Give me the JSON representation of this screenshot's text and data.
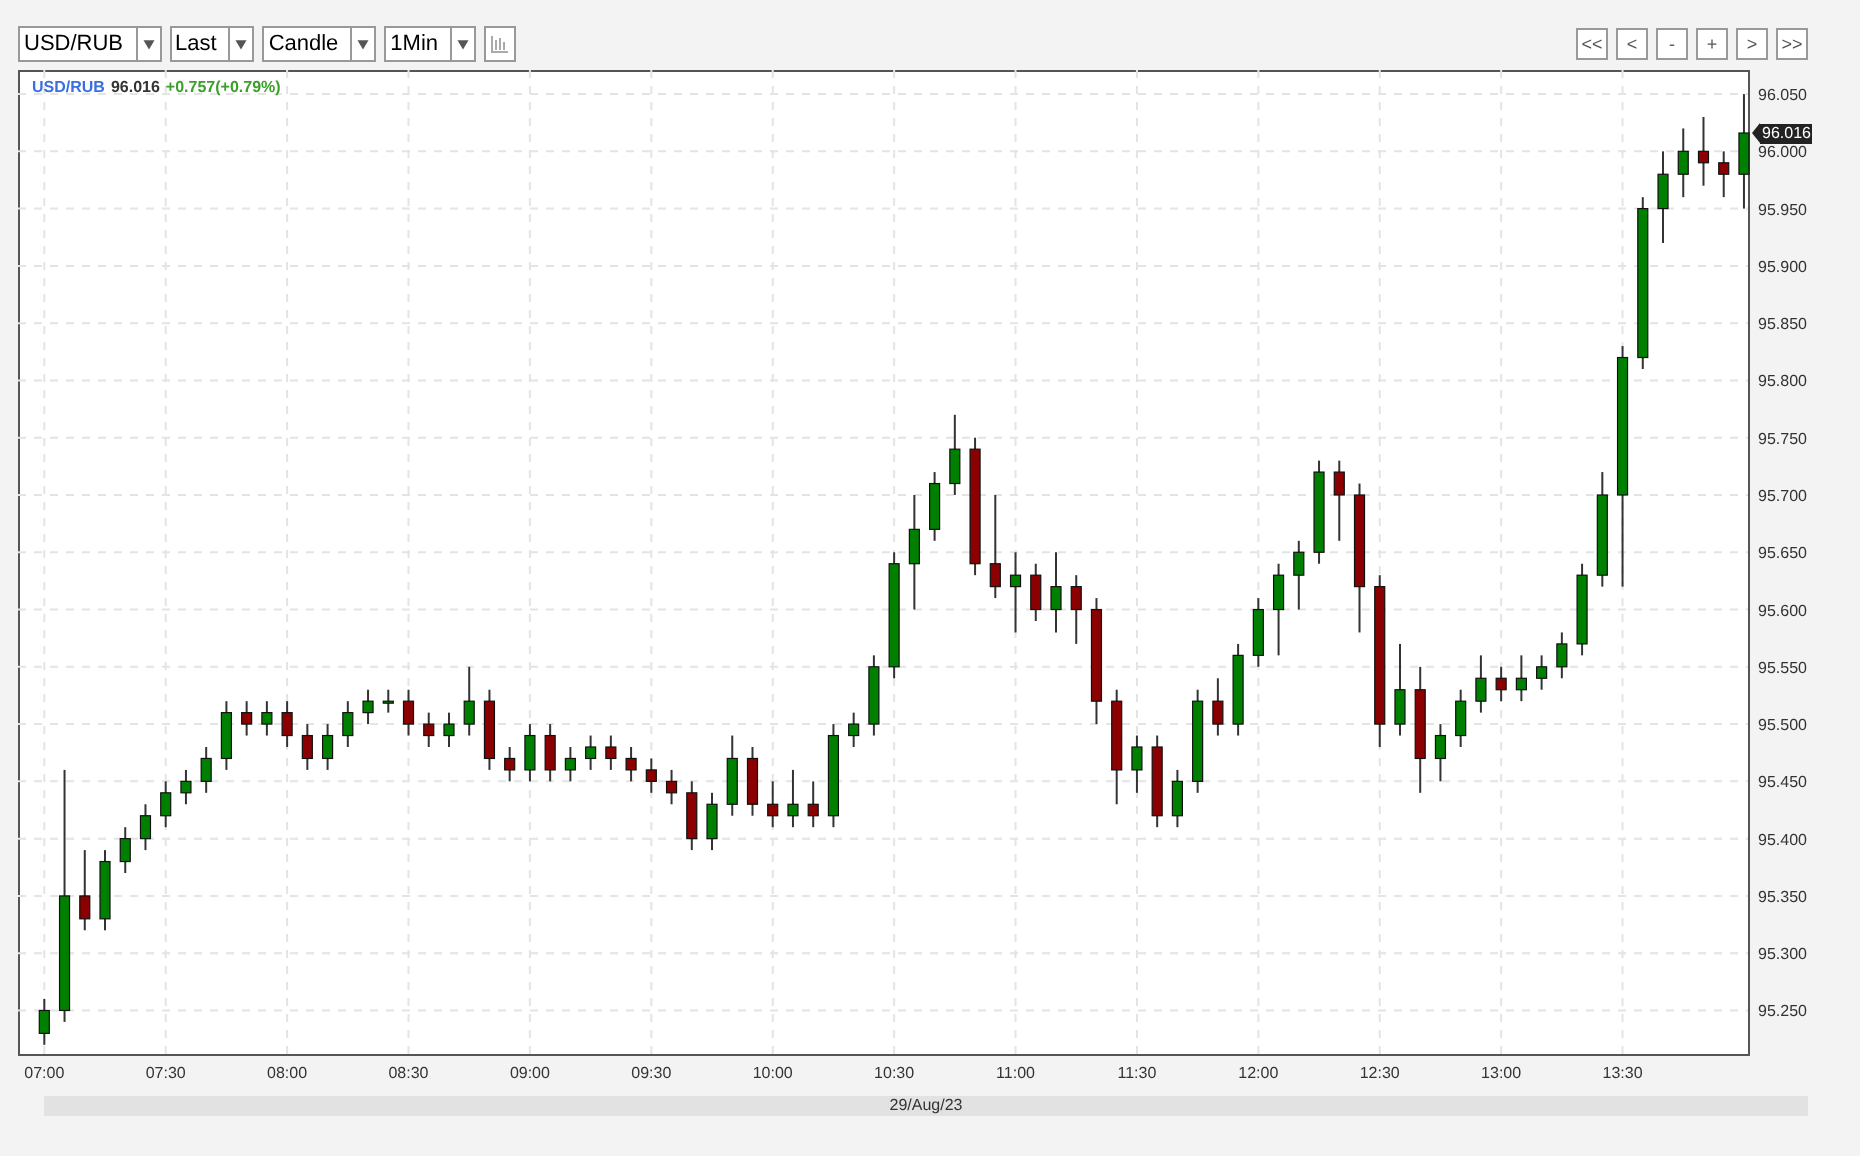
{
  "toolbar": {
    "selects": [
      "USD/RUB",
      "Last",
      "Candle",
      "1Min"
    ],
    "nav_buttons": [
      "<<",
      "<",
      "-",
      "+",
      ">",
      ">>"
    ]
  },
  "legend": {
    "symbol": "USD/RUB",
    "price": "96.016",
    "change": "+0.757(+0.79%)"
  },
  "price_marker": "96.016",
  "chart_data": {
    "type": "candlestick",
    "grid": true,
    "ylim": [
      95.212,
      96.071
    ],
    "categories": [
      "07:00",
      null,
      null,
      null,
      null,
      null,
      "07:30",
      null,
      null,
      null,
      null,
      null,
      "08:00",
      null,
      null,
      null,
      null,
      null,
      "08:30",
      null,
      null,
      null,
      null,
      null,
      "09:00",
      null,
      null,
      null,
      null,
      null,
      "09:30",
      null,
      null,
      null,
      null,
      null,
      "10:00",
      null,
      null,
      null,
      null,
      null,
      "10:30",
      null,
      null,
      null,
      null,
      null,
      "11:00",
      null,
      null,
      null,
      null,
      null,
      "11:30",
      null,
      null,
      null,
      null,
      null,
      "12:00",
      null,
      null,
      null,
      null,
      null,
      "12:30",
      null,
      null,
      null,
      null,
      null,
      "13:00",
      null,
      null,
      null,
      null,
      null,
      "13:30",
      null,
      null,
      null,
      null,
      null,
      null
    ],
    "yticks": [
      {
        "value": 95.25,
        "label": "95.250"
      },
      {
        "value": 95.3,
        "label": "95.300"
      },
      {
        "value": 95.35,
        "label": "95.350"
      },
      {
        "value": 95.4,
        "label": "95.400"
      },
      {
        "value": 95.45,
        "label": "95.450"
      },
      {
        "value": 95.5,
        "label": "95.500"
      },
      {
        "value": 95.55,
        "label": "95.550"
      },
      {
        "value": 95.6,
        "label": "95.600"
      },
      {
        "value": 95.65,
        "label": "95.650"
      },
      {
        "value": 95.7,
        "label": "95.700"
      },
      {
        "value": 95.75,
        "label": "95.750"
      },
      {
        "value": 95.8,
        "label": "95.800"
      },
      {
        "value": 95.85,
        "label": "95.850"
      },
      {
        "value": 95.9,
        "label": "95.900"
      },
      {
        "value": 95.95,
        "label": "95.950"
      },
      {
        "value": 96.0,
        "label": "96.000"
      },
      {
        "value": 96.05,
        "label": "96.050"
      }
    ],
    "ohlc": [
      [
        95.23,
        95.26,
        95.22,
        95.25
      ],
      [
        95.25,
        95.46,
        95.24,
        95.35
      ],
      [
        95.35,
        95.39,
        95.32,
        95.33
      ],
      [
        95.33,
        95.39,
        95.32,
        95.38
      ],
      [
        95.38,
        95.41,
        95.37,
        95.4
      ],
      [
        95.4,
        95.43,
        95.39,
        95.42
      ],
      [
        95.42,
        95.45,
        95.41,
        95.44
      ],
      [
        95.44,
        95.46,
        95.43,
        95.45
      ],
      [
        95.45,
        95.48,
        95.44,
        95.47
      ],
      [
        95.47,
        95.52,
        95.46,
        95.51
      ],
      [
        95.51,
        95.52,
        95.49,
        95.5
      ],
      [
        95.5,
        95.52,
        95.49,
        95.51
      ],
      [
        95.51,
        95.52,
        95.48,
        95.49
      ],
      [
        95.49,
        95.5,
        95.46,
        95.47
      ],
      [
        95.47,
        95.5,
        95.46,
        95.49
      ],
      [
        95.49,
        95.52,
        95.48,
        95.51
      ],
      [
        95.51,
        95.53,
        95.5,
        95.52
      ],
      [
        95.52,
        95.53,
        95.51,
        95.52
      ],
      [
        95.52,
        95.53,
        95.49,
        95.5
      ],
      [
        95.5,
        95.51,
        95.48,
        95.49
      ],
      [
        95.49,
        95.51,
        95.48,
        95.5
      ],
      [
        95.5,
        95.55,
        95.49,
        95.52
      ],
      [
        95.52,
        95.53,
        95.46,
        95.47
      ],
      [
        95.47,
        95.48,
        95.45,
        95.46
      ],
      [
        95.46,
        95.5,
        95.45,
        95.49
      ],
      [
        95.49,
        95.5,
        95.45,
        95.46
      ],
      [
        95.46,
        95.48,
        95.45,
        95.47
      ],
      [
        95.47,
        95.49,
        95.46,
        95.48
      ],
      [
        95.48,
        95.49,
        95.46,
        95.47
      ],
      [
        95.47,
        95.48,
        95.45,
        95.46
      ],
      [
        95.46,
        95.47,
        95.44,
        95.45
      ],
      [
        95.45,
        95.46,
        95.43,
        95.44
      ],
      [
        95.44,
        95.45,
        95.39,
        95.4
      ],
      [
        95.4,
        95.44,
        95.39,
        95.43
      ],
      [
        95.43,
        95.49,
        95.42,
        95.47
      ],
      [
        95.47,
        95.48,
        95.42,
        95.43
      ],
      [
        95.43,
        95.45,
        95.41,
        95.42
      ],
      [
        95.42,
        95.46,
        95.41,
        95.43
      ],
      [
        95.43,
        95.45,
        95.41,
        95.42
      ],
      [
        95.42,
        95.5,
        95.41,
        95.49
      ],
      [
        95.49,
        95.51,
        95.48,
        95.5
      ],
      [
        95.5,
        95.56,
        95.49,
        95.55
      ],
      [
        95.55,
        95.65,
        95.54,
        95.64
      ],
      [
        95.64,
        95.7,
        95.6,
        95.67
      ],
      [
        95.67,
        95.72,
        95.66,
        95.71
      ],
      [
        95.71,
        95.77,
        95.7,
        95.74
      ],
      [
        95.74,
        95.75,
        95.63,
        95.64
      ],
      [
        95.64,
        95.7,
        95.61,
        95.62
      ],
      [
        95.62,
        95.65,
        95.58,
        95.63
      ],
      [
        95.63,
        95.64,
        95.59,
        95.6
      ],
      [
        95.6,
        95.65,
        95.58,
        95.62
      ],
      [
        95.62,
        95.63,
        95.57,
        95.6
      ],
      [
        95.6,
        95.61,
        95.5,
        95.52
      ],
      [
        95.52,
        95.53,
        95.43,
        95.46
      ],
      [
        95.46,
        95.49,
        95.44,
        95.48
      ],
      [
        95.48,
        95.49,
        95.41,
        95.42
      ],
      [
        95.42,
        95.46,
        95.41,
        95.45
      ],
      [
        95.45,
        95.53,
        95.44,
        95.52
      ],
      [
        95.52,
        95.54,
        95.49,
        95.5
      ],
      [
        95.5,
        95.57,
        95.49,
        95.56
      ],
      [
        95.56,
        95.61,
        95.55,
        95.6
      ],
      [
        95.6,
        95.64,
        95.56,
        95.63
      ],
      [
        95.63,
        95.66,
        95.6,
        95.65
      ],
      [
        95.65,
        95.73,
        95.64,
        95.72
      ],
      [
        95.72,
        95.73,
        95.66,
        95.7
      ],
      [
        95.7,
        95.71,
        95.58,
        95.62
      ],
      [
        95.62,
        95.63,
        95.48,
        95.5
      ],
      [
        95.5,
        95.57,
        95.49,
        95.53
      ],
      [
        95.53,
        95.55,
        95.44,
        95.47
      ],
      [
        95.47,
        95.5,
        95.45,
        95.49
      ],
      [
        95.49,
        95.53,
        95.48,
        95.52
      ],
      [
        95.52,
        95.56,
        95.51,
        95.54
      ],
      [
        95.54,
        95.55,
        95.52,
        95.53
      ],
      [
        95.53,
        95.56,
        95.52,
        95.54
      ],
      [
        95.54,
        95.56,
        95.53,
        95.55
      ],
      [
        95.55,
        95.58,
        95.54,
        95.57
      ],
      [
        95.57,
        95.64,
        95.56,
        95.63
      ],
      [
        95.63,
        95.72,
        95.62,
        95.7
      ],
      [
        95.7,
        95.83,
        95.62,
        95.82
      ],
      [
        95.82,
        95.96,
        95.81,
        95.95
      ],
      [
        95.95,
        96.0,
        95.92,
        95.98
      ],
      [
        95.98,
        96.02,
        95.96,
        96.0
      ],
      [
        96.0,
        96.03,
        95.97,
        95.99
      ],
      [
        95.99,
        96.0,
        95.96,
        95.98
      ],
      [
        95.98,
        96.05,
        95.95,
        96.016
      ]
    ]
  },
  "date_bar": "29/Aug/23"
}
